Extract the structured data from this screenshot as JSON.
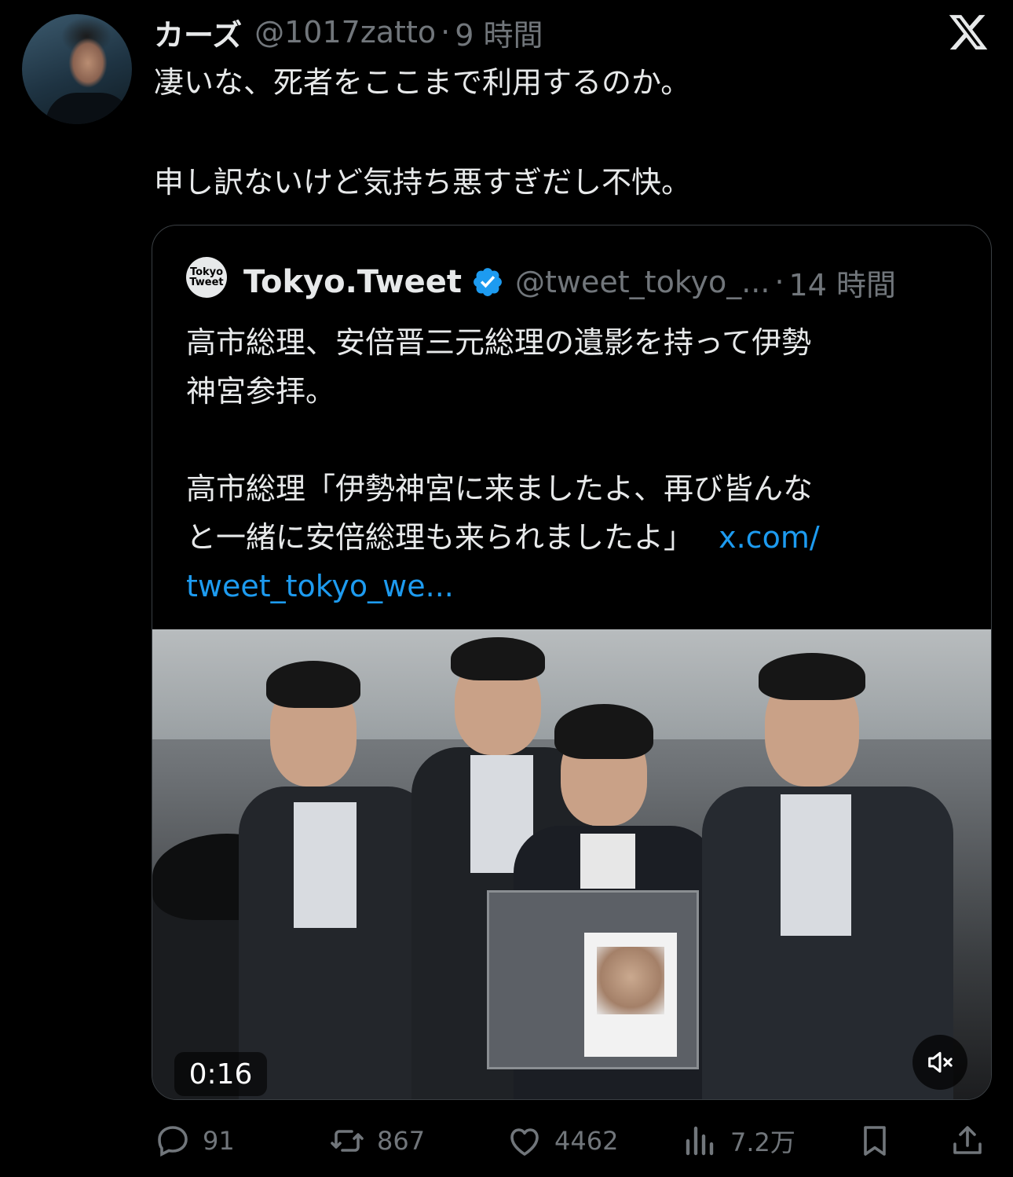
{
  "author": {
    "name": "カーズ",
    "handle": "@1017zatto",
    "separator": "·",
    "time": "9 時間"
  },
  "tweet": {
    "lines": [
      "凄いな、死者をここまで利用するのか。",
      "申し訳ないけど気持ち悪すぎだし不快。"
    ]
  },
  "quote": {
    "avatar_text_1": "Tokyo",
    "avatar_text_2": "Tweet",
    "name": "Tokyo.Tweet",
    "handle": "@tweet_tokyo_...",
    "separator": "·",
    "time": "14 時間",
    "lines": [
      "高市総理、安倍晋三元総理の遺影を持って伊勢",
      "神宮参拝。",
      "高市総理「伊勢神宮に来ましたよ、再び皆んな",
      "と一緒に安倍総理も来られましたよ」"
    ],
    "link_part1": "x.com/",
    "link_part2": "tweet_tokyo_we...",
    "video": {
      "duration": "0:16"
    }
  },
  "actions": {
    "replies": "91",
    "reposts": "867",
    "likes": "4462",
    "views": "7.2万"
  },
  "colors": {
    "background": "#000000",
    "text": "#e7e9ea",
    "secondary": "#71767b",
    "link": "#1d9bf0",
    "verified": "#1d9bf0",
    "border": "#3a3f43"
  },
  "icons": [
    "x-logo-icon",
    "verified-badge-icon",
    "mute-icon",
    "reply-icon",
    "repost-icon",
    "like-icon",
    "views-icon",
    "bookmark-icon",
    "share-icon"
  ]
}
